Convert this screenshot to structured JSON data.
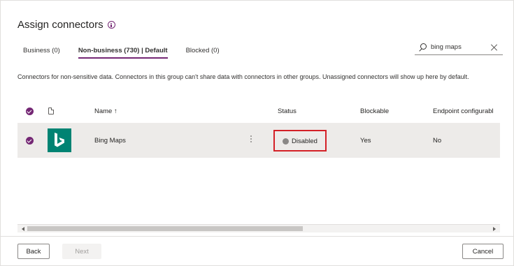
{
  "dialog": {
    "title": "Assign connectors",
    "info_icon": "info-icon"
  },
  "tabs": [
    {
      "label": "Business (0)",
      "active": false
    },
    {
      "label": "Non-business (730) | Default",
      "active": true
    },
    {
      "label": "Blocked (0)",
      "active": false
    }
  ],
  "search": {
    "value": "bing maps",
    "icon": "search-icon",
    "clear_icon": "close-icon"
  },
  "description": "Connectors for non-sensitive data. Connectors in this group can't share data with connectors in other groups. Unassigned connectors will show up here by default.",
  "table": {
    "columns": {
      "name": "Name ↑",
      "status": "Status",
      "blockable": "Blockable",
      "endpoint": "Endpoint configurabl"
    },
    "rows": [
      {
        "name": "Bing Maps",
        "icon": "bing-logo",
        "status": "Disabled",
        "blockable": "Yes",
        "endpoint": "No",
        "selected": true
      }
    ]
  },
  "footer": {
    "back": "Back",
    "next": "Next",
    "cancel": "Cancel"
  },
  "colors": {
    "accent": "#742774",
    "highlight_border": "#d42027",
    "bing_green": "#008373",
    "row_selected_bg": "#edebe9"
  }
}
